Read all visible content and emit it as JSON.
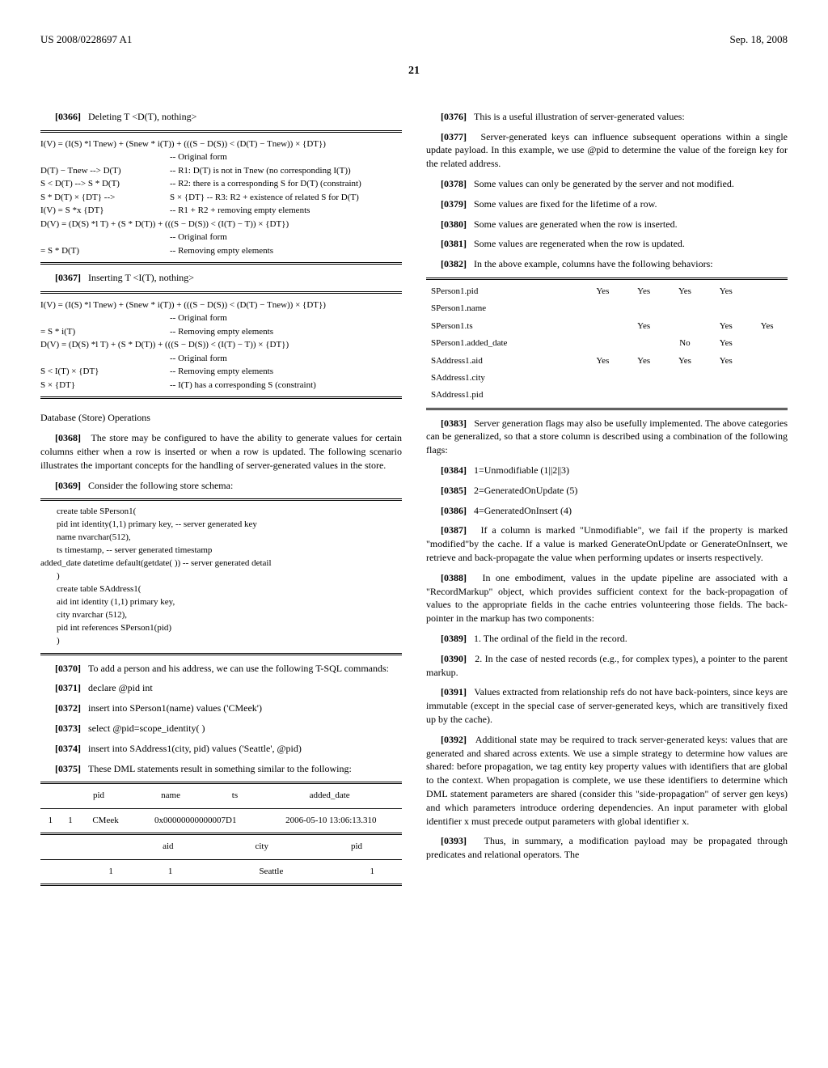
{
  "header": {
    "left": "US 2008/0228697 A1",
    "right": "Sep. 18, 2008"
  },
  "page_number": "21",
  "left": {
    "p0366": "Deleting T <D(T), nothing>",
    "formula1": {
      "line1": "I(V) = (I(S) *l Tnew) + (Snew * i(T)) + (((S − D(S)) < (D(T) − Tnew)) × {DT})",
      "rows": [
        [
          "",
          "-- Original form"
        ],
        [
          "D(T) − Tnew --> D(T)",
          "-- R1: D(T) is not in Tnew (no corresponding I(T))"
        ],
        [
          "S < D(T) --> S * D(T)",
          "-- R2: there is a corresponding S for D(T) (constraint)"
        ],
        [
          "S * D(T) × {DT} -->",
          "S × {DT} -- R3: R2 + existence of related S for D(T)"
        ],
        [
          "I(V) = S *x {DT}",
          "-- R1 + R2 + removing empty elements"
        ],
        [
          "D(V) = (D(S) *l T) + (S * D(T)) + (((S − D(S)) < (I(T) − T)) × {DT})",
          ""
        ],
        [
          "",
          "-- Original form"
        ],
        [
          "= S * D(T)",
          "-- Removing empty elements"
        ]
      ]
    },
    "p0367": "Inserting T <I(T), nothing>",
    "formula2": {
      "line1": "I(V) = (I(S) *l Tnew) + (Snew * i(T)) + (((S − D(S)) < (D(T) − Tnew)) × {DT})",
      "rows": [
        [
          "",
          "-- Original form"
        ],
        [
          "= S * i(T)",
          "-- Removing empty elements"
        ],
        [
          "D(V) = (D(S) *l T) + (S * D(T)) + (((S − D(S)) < (I(T) − T)) × {DT})",
          ""
        ],
        [
          "",
          "-- Original form"
        ],
        [
          "S < I(T) × {DT}",
          "-- Removing empty elements"
        ],
        [
          "S × {DT}",
          "-- I(T) has a corresponding S (constraint)"
        ]
      ]
    },
    "db_ops": "Database (Store) Operations",
    "p0368": "The store may be configured to have the ability to generate values for certain columns either when a row is inserted or when a row is updated. The following scenario illustrates the important concepts for the handling of server-generated values in the store.",
    "p0369": "Consider the following store schema:",
    "code1": [
      "create table SPerson1(",
      "  pid int identity(1,1) primary key, -- server generated key",
      "  name nvarchar(512),",
      "  ts timestamp, -- server generated timestamp",
      "  added_date datetime default(getdate( )) -- server generated detail",
      ")",
      "create table SAddress1(",
      "  aid int identity (1,1) primary key,",
      "  city nvarchar (512),",
      "  pid int references SPerson1(pid)",
      ")"
    ],
    "p0370": "To add a person and his address, we can use the following T-SQL commands:",
    "p0371": "declare @pid int",
    "p0372": "insert into SPerson1(name) values ('CMeek')",
    "p0373": "select @pid=scope_identity( )",
    "p0374": "insert into SAddress1(city, pid) values ('Seattle', @pid)",
    "p0375": "These DML statements result in something similar to the following:",
    "table1": {
      "headers": [
        "",
        "pid",
        "name",
        "ts",
        "added_date"
      ],
      "row1": [
        "1",
        "1",
        "CMeek",
        "0x00000000000007D1",
        "2006-05-10 13:06:13.310"
      ],
      "headers2": [
        "",
        "",
        "aid",
        "city",
        "pid"
      ],
      "row2": [
        "",
        "1",
        "1",
        "Seattle",
        "1"
      ]
    }
  },
  "right": {
    "p0376": "This is a useful illustration of server-generated values:",
    "p0377": "Server-generated keys can influence subsequent operations within a single update payload. In this example, we use @pid to determine the value of the foreign key for the related address.",
    "p0378": "Some values can only be generated by the server and not modified.",
    "p0379": "Some values are fixed for the lifetime of a row.",
    "p0380": "Some values are generated when the row is inserted.",
    "p0381": "Some values are regenerated when the row is updated.",
    "p0382": "In the above example, columns have the following behaviors:",
    "table2": {
      "rows": [
        [
          "SPerson1.pid",
          "Yes",
          "Yes",
          "Yes",
          "Yes",
          ""
        ],
        [
          "SPerson1.name",
          "",
          "",
          "",
          "",
          ""
        ],
        [
          "SPerson1.ts",
          "",
          "Yes",
          "",
          "Yes",
          "Yes"
        ],
        [
          "SPerson1.added_date",
          "",
          "",
          "No",
          "Yes",
          ""
        ],
        [
          "SAddress1.aid",
          "Yes",
          "Yes",
          "Yes",
          "Yes",
          ""
        ],
        [
          "SAddress1.city",
          "",
          "",
          "",
          "",
          ""
        ],
        [
          "SAddress1.pid",
          "",
          "",
          "",
          "",
          ""
        ]
      ]
    },
    "p0383": "Server generation flags may also be usefully implemented. The above categories can be generalized, so that a store column is described using a combination of the following flags:",
    "p0384": "1=Unmodifiable (1||2||3)",
    "p0385": "2=GeneratedOnUpdate (5)",
    "p0386": "4=GeneratedOnInsert (4)",
    "p0387": "If a column is marked \"Unmodifiable\", we fail if the property is marked \"modified\"by the cache. If a value is marked GenerateOnUpdate or GenerateOnInsert, we retrieve and back-propagate the value when performing updates or inserts respectively.",
    "p0388": "In one embodiment, values in the update pipeline are associated with a \"RecordMarkup\" object, which provides sufficient context for the back-propagation of values to the appropriate fields in the cache entries volunteering those fields. The back-pointer in the markup has two components:",
    "p0389": "1. The ordinal of the field in the record.",
    "p0390": "2. In the case of nested records (e.g., for complex types), a pointer to the parent markup.",
    "p0391": "Values extracted from relationship refs do not have back-pointers, since keys are immutable (except in the special case of server-generated keys, which are transitively fixed up by the cache).",
    "p0392": "Additional state may be required to track server-generated keys: values that are generated and shared across extents. We use a simple strategy to determine how values are shared: before propagation, we tag entity key property values with identifiers that are global to the context. When propagation is complete, we use these identifiers to determine which DML statement parameters are shared (consider this \"side-propagation\" of server gen keys) and which parameters introduce ordering dependencies. An input parameter with global identifier x must precede output parameters with global identifier x.",
    "p0393": "Thus, in summary, a modification payload may be propagated through predicates and relational operators. The"
  }
}
